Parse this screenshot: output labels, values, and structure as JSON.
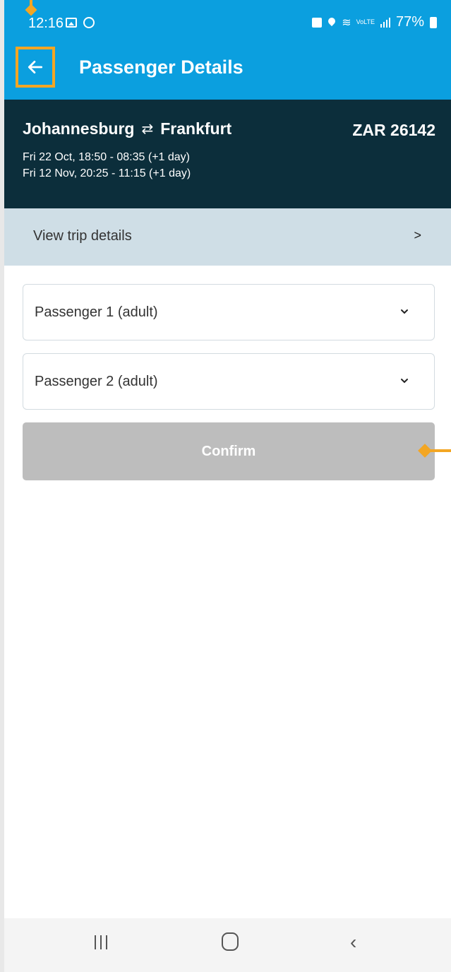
{
  "status_bar": {
    "time": "12:16",
    "battery": "77%",
    "network_label": "VoLTE"
  },
  "app_bar": {
    "title": "Passenger Details",
    "back_icon": "arrow-left-icon"
  },
  "trip": {
    "origin": "Johannesburg",
    "destination": "Frankfurt",
    "swap_icon": "⇄",
    "price": "ZAR 26142",
    "outbound": "Fri 22 Oct, 18:50 - 08:35 (+1 day)",
    "return": "Fri 12 Nov, 20:25 - 11:15 (+1 day)"
  },
  "trip_details": {
    "label": "View trip details",
    "chevron": ">"
  },
  "passengers": [
    {
      "label": "Passenger 1 (adult)"
    },
    {
      "label": "Passenger 2 (adult)"
    }
  ],
  "confirm": {
    "label": "Confirm"
  },
  "colors": {
    "app_bar": "#0b9fdf",
    "trip_header": "#0c2e3b",
    "trip_details_bg": "#cfdee6",
    "confirm_disabled": "#bdbdbd",
    "annotation": "#f3a623"
  }
}
